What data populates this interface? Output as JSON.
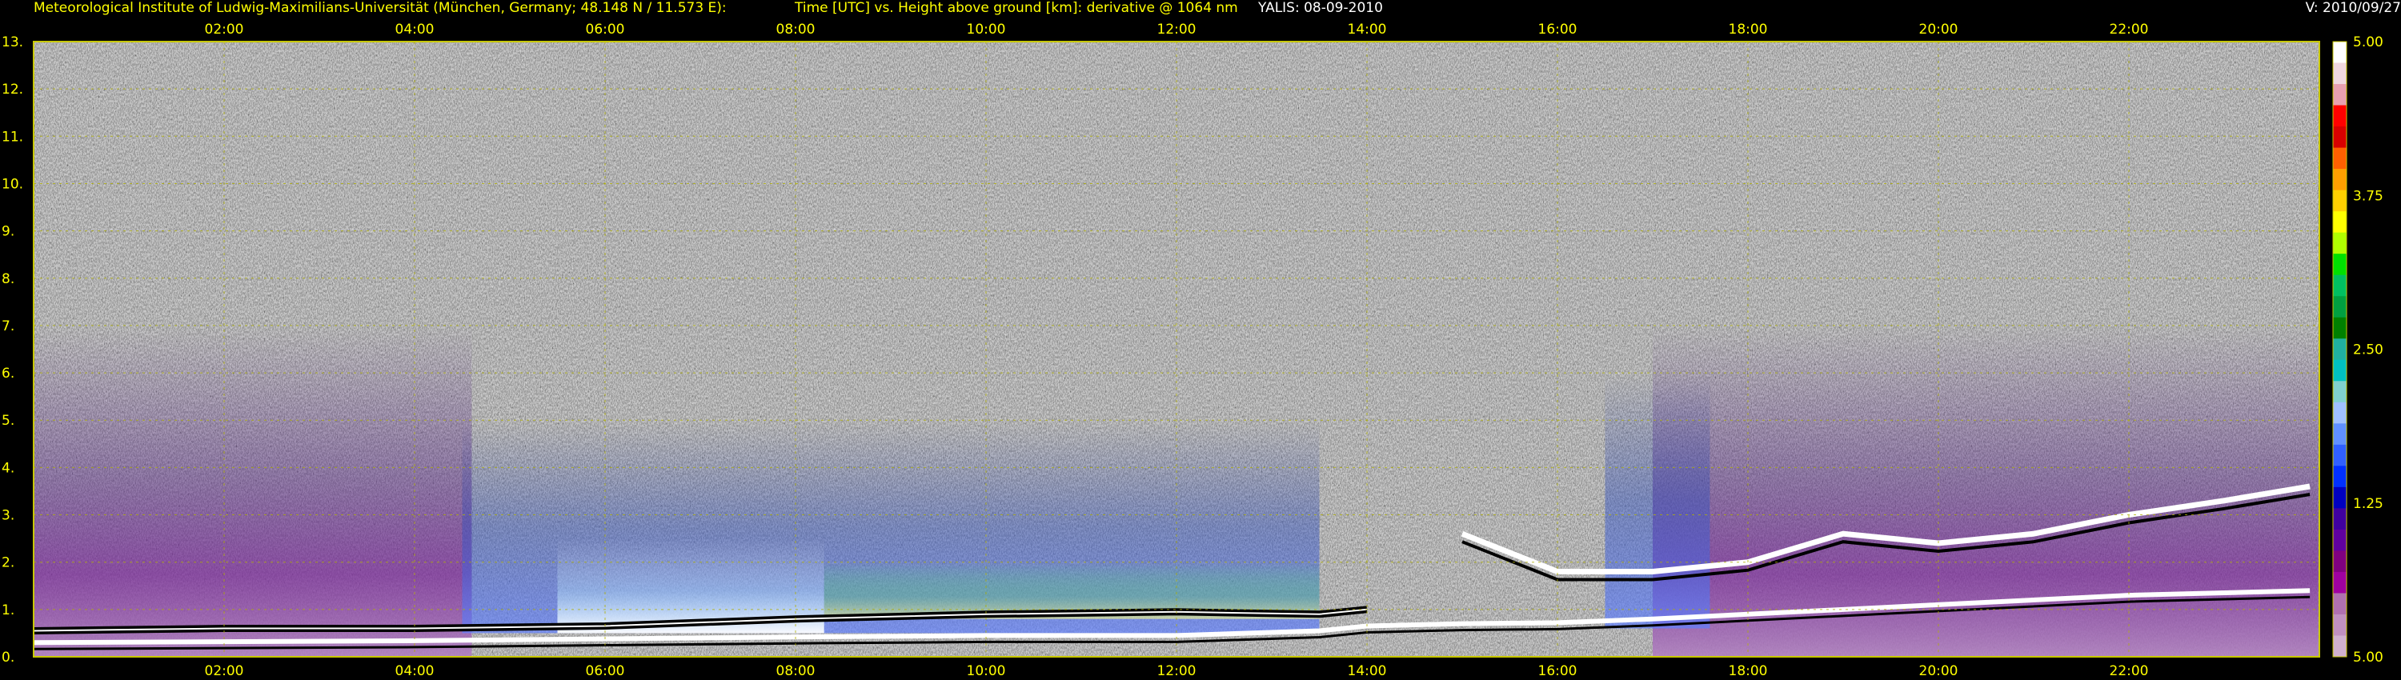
{
  "header": {
    "institute": "Meteorological Institute of Ludwig-Maximilians-Universität (München, Germany; 48.148 N / 11.573 E):",
    "plot_description": "Time [UTC] vs. Height above ground [km]: derivative @ 1064 nm",
    "station_date": "YALIS: 08-09-2010",
    "version": "V: 2010/09/27"
  },
  "chart_data": {
    "type": "heatmap",
    "x_axis": {
      "range_hours": [
        0,
        24
      ],
      "tick_labels": [
        "02:00",
        "04:00",
        "06:00",
        "08:00",
        "10:00",
        "12:00",
        "14:00",
        "16:00",
        "18:00",
        "20:00",
        "22:00"
      ],
      "tick_hours": [
        2,
        4,
        6,
        8,
        10,
        12,
        14,
        16,
        18,
        20,
        22
      ]
    },
    "y_axis": {
      "range_km": [
        0,
        13
      ],
      "tick_labels": [
        "0.",
        "1.",
        "2.",
        "3.",
        "4.",
        "5.",
        "6.",
        "7.",
        "8.",
        "9.",
        "10.",
        "11.",
        "12.",
        "13."
      ],
      "tick_values": [
        0,
        1,
        2,
        3,
        4,
        5,
        6,
        7,
        8,
        9,
        10,
        11,
        12,
        13
      ]
    },
    "grid": true,
    "colorbar": {
      "labels": [
        "5.00",
        "3.75",
        "2.50",
        "1.25",
        "5.00"
      ],
      "label_values": [
        5.0,
        3.75,
        2.5,
        1.25,
        0
      ],
      "colors": [
        "#ffffff",
        "#f0d8e0",
        "#e8a0b0",
        "#ff0000",
        "#d80000",
        "#ff6000",
        "#ffa000",
        "#ffd000",
        "#ffff00",
        "#b0ff00",
        "#00e000",
        "#00c060",
        "#00a040",
        "#008000",
        "#20b0a0",
        "#00c0c0",
        "#80d0d0",
        "#a0c0ff",
        "#6090ff",
        "#3060ff",
        "#0030ff",
        "#0000c0",
        "#4000a0",
        "#6000a0",
        "#800080",
        "#a000a0",
        "#b070b0",
        "#c090c0",
        "#d0b0d0"
      ]
    },
    "features": {
      "surface_layer_top_km": [
        [
          0,
          0.3
        ],
        [
          2,
          0.32
        ],
        [
          4,
          0.34
        ],
        [
          6,
          0.38
        ],
        [
          8,
          0.42
        ],
        [
          10,
          0.45
        ],
        [
          12,
          0.45
        ],
        [
          13.5,
          0.55
        ],
        [
          14,
          0.65
        ],
        [
          15,
          0.7
        ],
        [
          16,
          0.72
        ],
        [
          17,
          0.8
        ],
        [
          18,
          0.9
        ],
        [
          20,
          1.1
        ],
        [
          22,
          1.3
        ],
        [
          23.9,
          1.4
        ]
      ],
      "residual_layer_km": [
        [
          0,
          0.55
        ],
        [
          2,
          0.6
        ],
        [
          4,
          0.6
        ],
        [
          6,
          0.65
        ],
        [
          8,
          0.8
        ],
        [
          10,
          0.9
        ],
        [
          12,
          0.95
        ],
        [
          13.5,
          0.9
        ],
        [
          14,
          1.0
        ]
      ],
      "cloud_top_evening_km": [
        [
          15,
          2.6
        ],
        [
          16,
          1.8
        ],
        [
          17,
          1.8
        ],
        [
          18,
          2.0
        ],
        [
          19,
          2.6
        ],
        [
          20,
          2.4
        ],
        [
          21,
          2.6
        ],
        [
          22,
          3.0
        ],
        [
          23,
          3.3
        ],
        [
          23.9,
          3.6
        ]
      ]
    }
  }
}
